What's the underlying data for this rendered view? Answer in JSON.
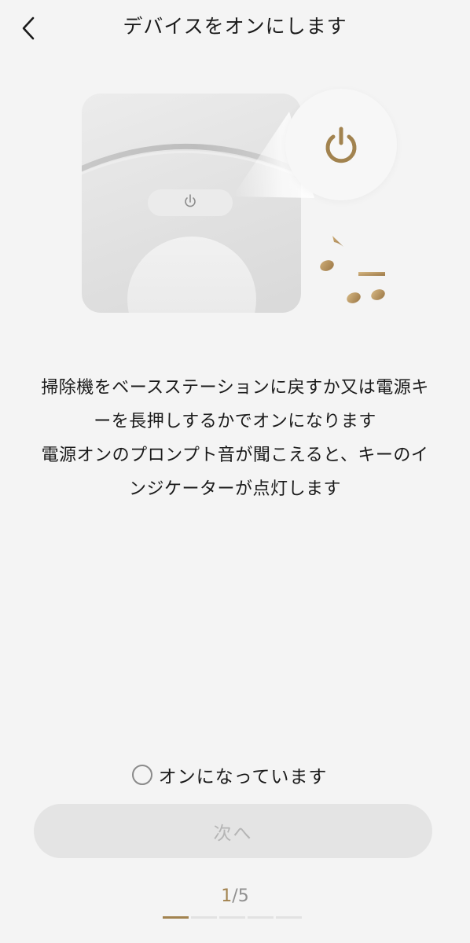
{
  "header": {
    "title": "デバイスをオンにします"
  },
  "illustration": {
    "power_icon": "power-icon",
    "note_icons": [
      "eighth-note-icon",
      "beamed-notes-icon"
    ],
    "accent_color": "#a2834f"
  },
  "description": {
    "lines": [
      "掃除機をベースステーションに戻すか又は電源キ",
      "ーを長押しするかでオンになります",
      "電源オンのプロンプト音が聞こえると、キーのイ",
      "ンジケーターが点灯します"
    ]
  },
  "confirm": {
    "label": "オンになっています",
    "checked": false
  },
  "next_button": {
    "label": "次へ",
    "enabled": false
  },
  "pager": {
    "current": "1",
    "separator": "/",
    "total": "5",
    "steps": 5,
    "active_step": 1
  }
}
